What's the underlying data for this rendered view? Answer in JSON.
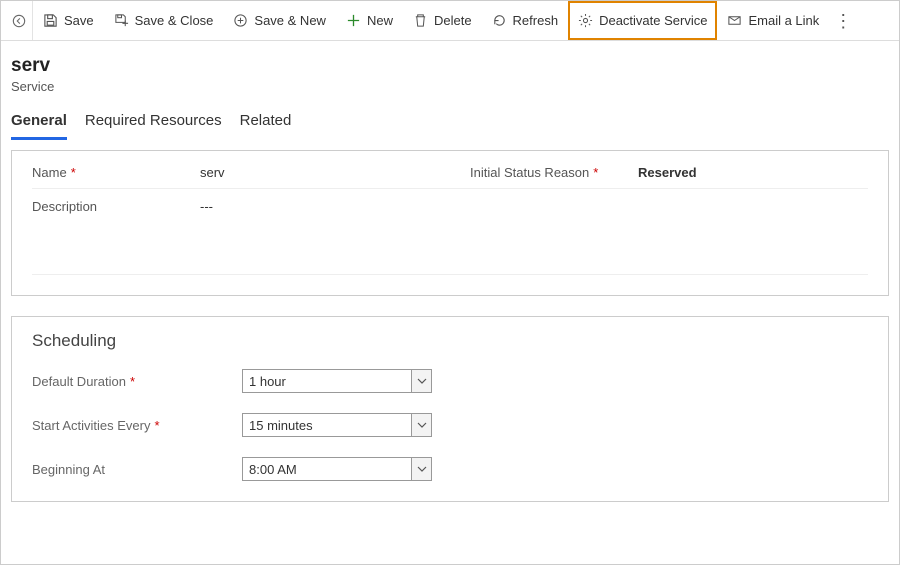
{
  "toolbar": {
    "save": "Save",
    "save_close": "Save & Close",
    "save_new": "Save & New",
    "new": "New",
    "delete": "Delete",
    "refresh": "Refresh",
    "deactivate": "Deactivate Service",
    "email_link": "Email a Link"
  },
  "record": {
    "title": "serv",
    "entity": "Service"
  },
  "tabs": [
    {
      "label": "General",
      "active": true
    },
    {
      "label": "Required Resources",
      "active": false
    },
    {
      "label": "Related",
      "active": false
    }
  ],
  "general": {
    "name_label": "Name",
    "name_value": "serv",
    "status_label": "Initial Status Reason",
    "status_value": "Reserved",
    "description_label": "Description",
    "description_value": "---"
  },
  "scheduling": {
    "heading": "Scheduling",
    "default_duration_label": "Default Duration",
    "default_duration_value": "1 hour",
    "start_every_label": "Start Activities Every",
    "start_every_value": "15 minutes",
    "beginning_at_label": "Beginning At",
    "beginning_at_value": "8:00 AM"
  }
}
